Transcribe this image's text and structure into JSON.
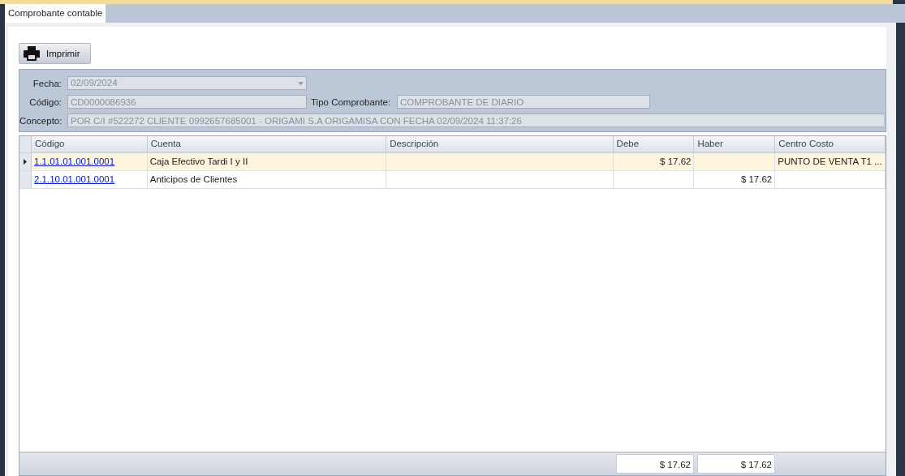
{
  "tabs": [
    {
      "label": "Comprobante contable",
      "selected": true
    }
  ],
  "toolbar": {
    "print_button": "Imprimir"
  },
  "form": {
    "fecha": {
      "label": "Fecha:",
      "value": "02/09/2024"
    },
    "codigo": {
      "label": "Código:",
      "value": "CD0000086936"
    },
    "tipo_comprobante": {
      "label": "Tipo Comprobante:",
      "value": "COMPROBANTE DE DIARIO"
    },
    "concepto": {
      "label": "Concepto:",
      "value": "POR C/I #522272 CLIENTE 0992657685001 - ORIGAMI S.A ORIGAMISA CON FECHA 02/09/2024 11:37:26"
    }
  },
  "table": {
    "columns": [
      "Código",
      "Cuenta",
      "Descripción",
      "Debe",
      "Haber",
      "Centro Costo"
    ],
    "rows": [
      {
        "selected": true,
        "cells": [
          "1.1.01.01.001.0001",
          "Caja Efectivo Tardi I y II",
          "",
          "$ 17.62",
          "",
          "PUNTO DE VENTA T1 ..."
        ]
      },
      {
        "selected": false,
        "cells": [
          "2.1.10.01.001.0001",
          "Anticipos de Clientes",
          "",
          "",
          "$ 17.62",
          ""
        ]
      }
    ],
    "totals": {
      "debe": "$ 17.62",
      "haber": "$ 17.62"
    }
  }
}
